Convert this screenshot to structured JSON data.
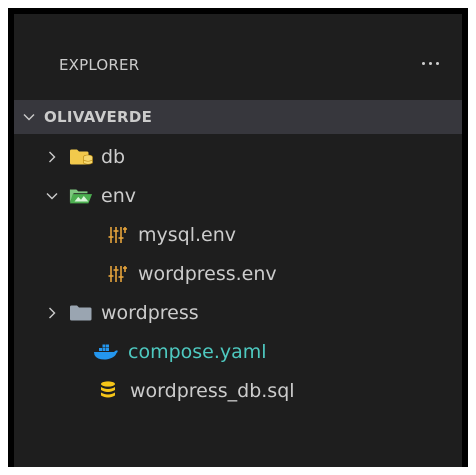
{
  "explorer": {
    "title": "EXPLORER",
    "more_icon": "ellipsis-icon"
  },
  "tree": {
    "root": {
      "label": "OLIVAVERDE",
      "expanded": true
    },
    "items": [
      {
        "label": "db",
        "type": "folder",
        "icon": "database-folder-icon",
        "expanded": false
      },
      {
        "label": "env",
        "type": "folder",
        "icon": "environment-folder-icon",
        "expanded": true
      },
      {
        "label": "mysql.env",
        "type": "file",
        "icon": "env-settings-icon"
      },
      {
        "label": "wordpress.env",
        "type": "file",
        "icon": "env-settings-icon"
      },
      {
        "label": "wordpress",
        "type": "folder",
        "icon": "folder-icon",
        "expanded": false
      },
      {
        "label": "compose.yaml",
        "type": "file",
        "icon": "docker-icon"
      },
      {
        "label": "wordpress_db.sql",
        "type": "file",
        "icon": "database-icon"
      }
    ]
  },
  "colors": {
    "panel_bg": "#1e1e1e",
    "root_row_bg": "#37373d",
    "text": "#cccccc",
    "docker_text": "#4ec9c0",
    "folder_yellow": "#f2c94c",
    "folder_gray": "#9aa5b1",
    "env_green": "#4caf50",
    "docker_blue": "#2496ed"
  }
}
